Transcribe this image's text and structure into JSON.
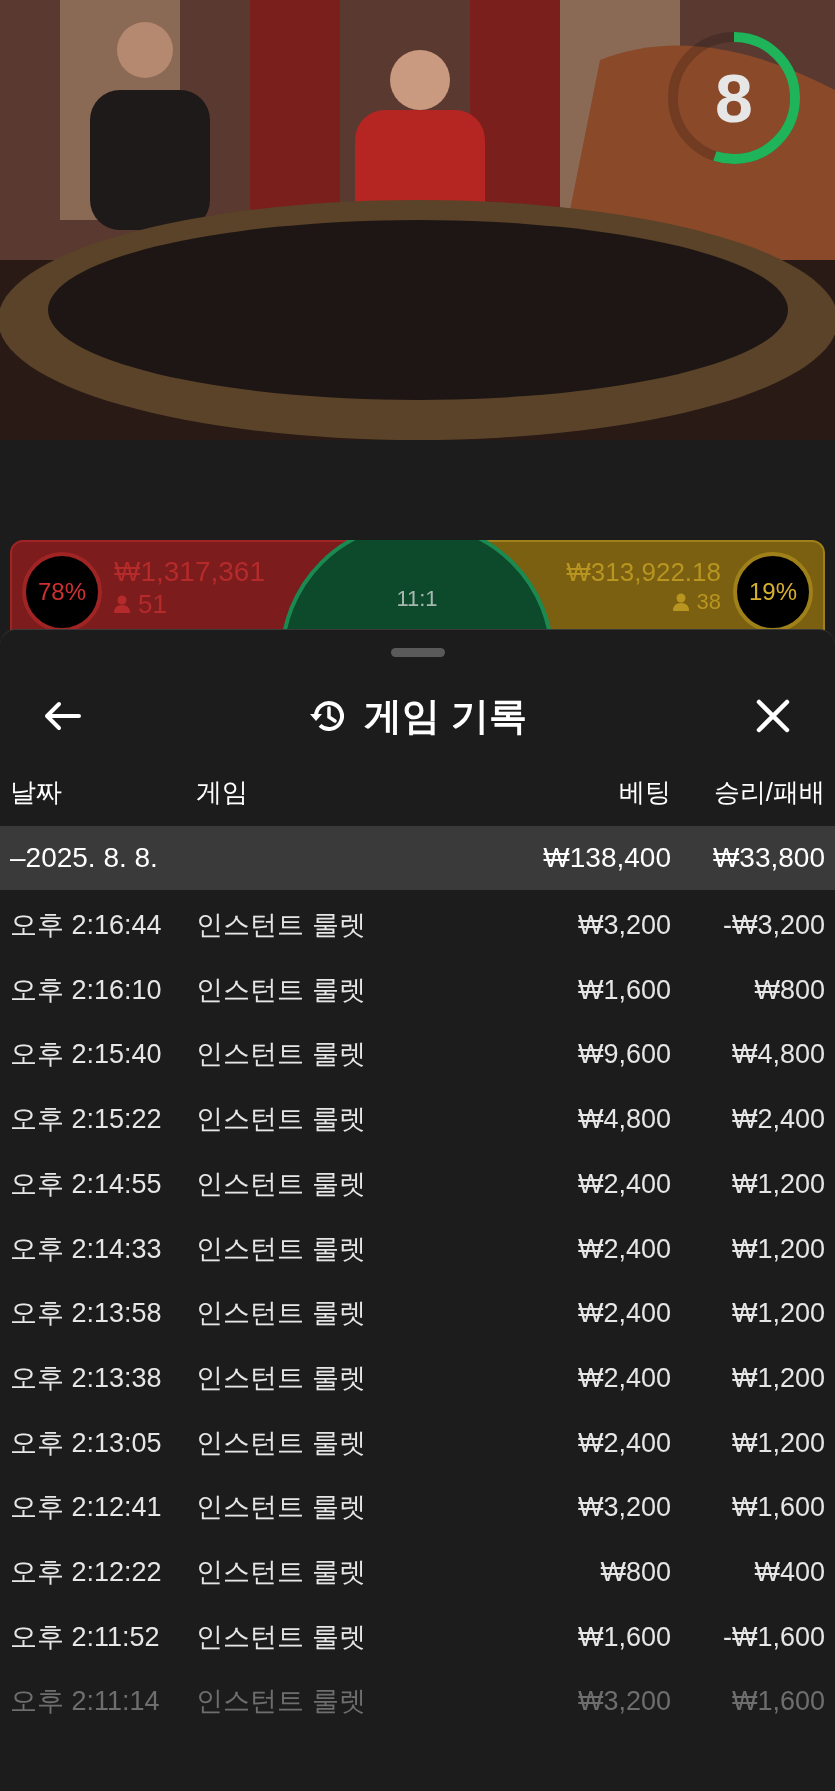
{
  "timer": {
    "count": "8",
    "level": 0.55
  },
  "bets": {
    "left": {
      "percent": "78%",
      "amount": "₩1,317,361",
      "players": "51"
    },
    "center": {
      "odds": "11:1"
    },
    "right": {
      "percent": "19%",
      "amount": "₩313,922.18",
      "players": "38"
    }
  },
  "sheet": {
    "title": "게임 기록",
    "columns": [
      "날짜",
      "게임",
      "베팅",
      "승리/패배"
    ],
    "summary": {
      "date": "–2025. 8. 8.",
      "bet": "₩138,400",
      "result": "₩33,800"
    },
    "rows": [
      {
        "time": "오후 2:16:44",
        "game": "인스턴트 룰렛",
        "bet": "₩3,200",
        "result": "-₩3,200",
        "dimmed": false
      },
      {
        "time": "오후 2:16:10",
        "game": "인스턴트 룰렛",
        "bet": "₩1,600",
        "result": "₩800",
        "dimmed": false
      },
      {
        "time": "오후 2:15:40",
        "game": "인스턴트 룰렛",
        "bet": "₩9,600",
        "result": "₩4,800",
        "dimmed": false
      },
      {
        "time": "오후 2:15:22",
        "game": "인스턴트 룰렛",
        "bet": "₩4,800",
        "result": "₩2,400",
        "dimmed": false
      },
      {
        "time": "오후 2:14:55",
        "game": "인스턴트 룰렛",
        "bet": "₩2,400",
        "result": "₩1,200",
        "dimmed": false
      },
      {
        "time": "오후 2:14:33",
        "game": "인스턴트 룰렛",
        "bet": "₩2,400",
        "result": "₩1,200",
        "dimmed": false
      },
      {
        "time": "오후 2:13:58",
        "game": "인스턴트 룰렛",
        "bet": "₩2,400",
        "result": "₩1,200",
        "dimmed": false
      },
      {
        "time": "오후 2:13:38",
        "game": "인스턴트 룰렛",
        "bet": "₩2,400",
        "result": "₩1,200",
        "dimmed": false
      },
      {
        "time": "오후 2:13:05",
        "game": "인스턴트 룰렛",
        "bet": "₩2,400",
        "result": "₩1,200",
        "dimmed": false
      },
      {
        "time": "오후 2:12:41",
        "game": "인스턴트 룰렛",
        "bet": "₩3,200",
        "result": "₩1,600",
        "dimmed": false
      },
      {
        "time": "오후 2:12:22",
        "game": "인스턴트 룰렛",
        "bet": "₩800",
        "result": "₩400",
        "dimmed": false
      },
      {
        "time": "오후 2:11:52",
        "game": "인스턴트 룰렛",
        "bet": "₩1,600",
        "result": "-₩1,600",
        "dimmed": false
      },
      {
        "time": "오후 2:11:14",
        "game": "인스턴트 룰렛",
        "bet": "₩3,200",
        "result": "₩1,600",
        "dimmed": true
      }
    ]
  }
}
